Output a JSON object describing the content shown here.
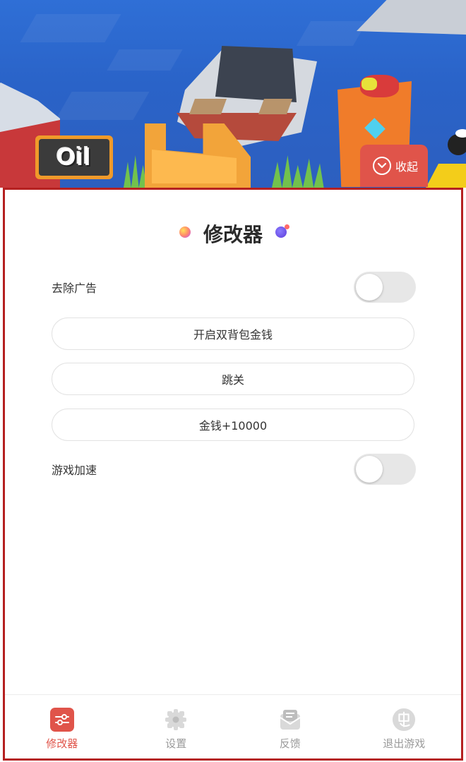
{
  "game_scene": {
    "sign_text": "Oil",
    "collapse_button": {
      "label": "收起",
      "icon": "chevron-down-circle-icon"
    }
  },
  "panel": {
    "title": "修改器",
    "toggles": [
      {
        "label": "去除广告",
        "on": false
      },
      {
        "label": "游戏加速",
        "on": false
      }
    ],
    "buttons": [
      {
        "label": "开启双背包金钱"
      },
      {
        "label": "跳关"
      },
      {
        "label": "金钱+10000"
      }
    ]
  },
  "bottom_nav": {
    "items": [
      {
        "label": "修改器",
        "icon": "sliders-icon",
        "active": true
      },
      {
        "label": "设置",
        "icon": "gear-icon",
        "active": false
      },
      {
        "label": "反馈",
        "icon": "message-icon",
        "active": false
      },
      {
        "label": "退出游戏",
        "icon": "exit-game-icon",
        "active": false
      }
    ]
  },
  "colors": {
    "accent": "#e0544a",
    "panel_border": "#b52020",
    "inactive": "#9a9a9a",
    "toggle_off": "#e7e7e7"
  }
}
